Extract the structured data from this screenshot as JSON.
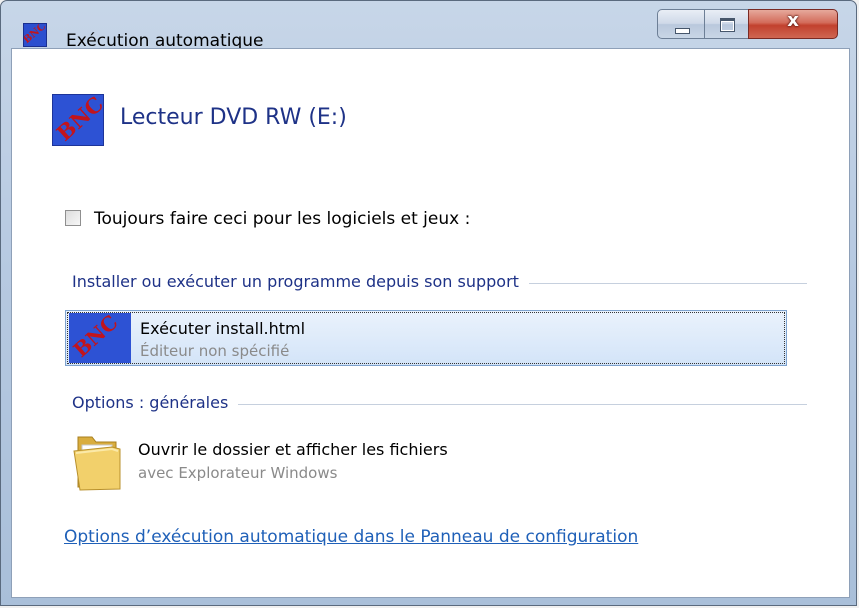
{
  "window": {
    "title": "Exécution automatique",
    "app_icon_text": "BNC",
    "caption_buttons": {
      "close_glyph": "x"
    }
  },
  "drive": {
    "icon_text": "BNC",
    "title": "Lecteur DVD RW (E:)"
  },
  "always_checkbox": {
    "label": "Toujours faire ceci pour les logiciels et jeux :",
    "checked": false
  },
  "sections": {
    "install_heading": "Installer ou exécuter un programme depuis son support",
    "general_heading": "Options : générales"
  },
  "options": {
    "run": {
      "icon_text": "BNC",
      "title": "Exécuter install.html",
      "subtitle": "Éditeur non spécifié",
      "selected": true
    },
    "open_folder": {
      "icon": "folder-icon",
      "title": "Ouvrir le dossier et afficher les fichiers",
      "subtitle": "avec Explorateur Windows"
    }
  },
  "footer": {
    "control_panel_link": "Options d’exécution automatique dans le Panneau de configuration"
  },
  "colors": {
    "heading_blue": "#1e3287",
    "link_blue": "#1f60b8",
    "selection_bg": "#d3e4f8",
    "bnc_red": "#c2141c",
    "bnc_blue": "#2d52d4"
  }
}
